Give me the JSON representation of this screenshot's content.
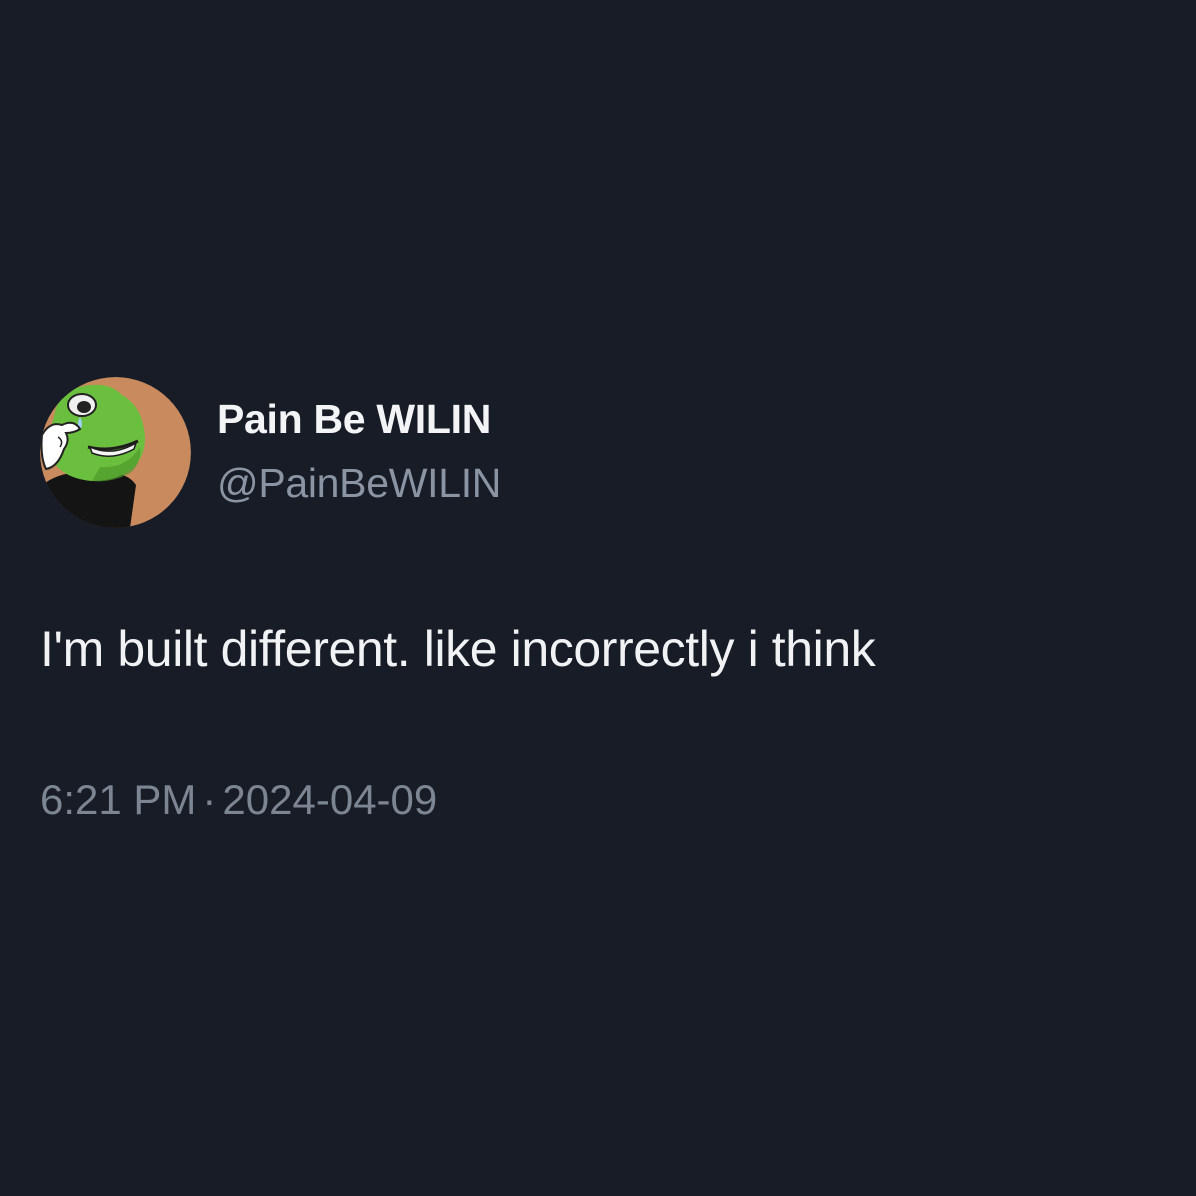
{
  "tweet": {
    "author": {
      "display_name": "Pain Be WILIN",
      "handle": "@PainBeWILIN",
      "avatar_icon": "frog-avatar-icon"
    },
    "text": "I'm built different. like incorrectly i think",
    "time": "6:21 PM",
    "separator": "·",
    "date": "2024-04-09"
  },
  "colors": {
    "background": "#171c27",
    "primary_text": "#f1f2f4",
    "secondary_text": "#8b94a3",
    "avatar_bg": "#c98a5e",
    "avatar_frog": "#6bbf3f"
  }
}
